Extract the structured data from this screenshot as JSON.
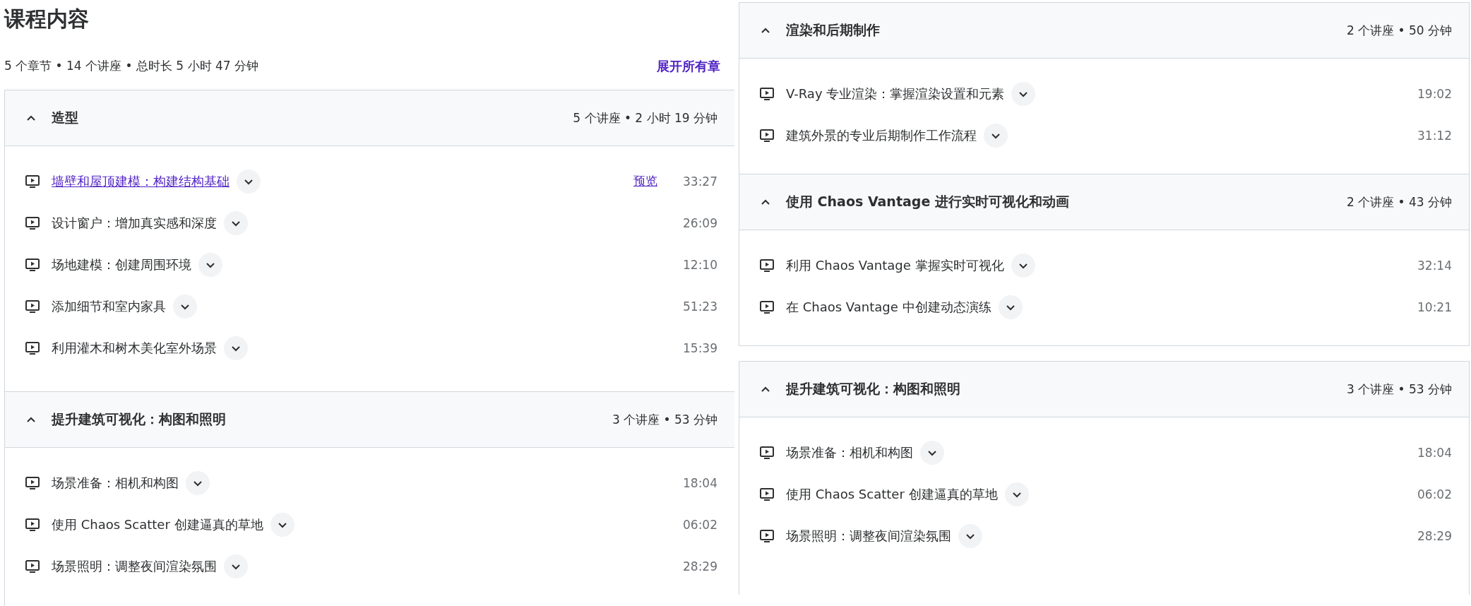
{
  "left_panel": {
    "title": "课程内容",
    "summary": "5 个章节 • 14 个讲座 • 总时长 5 小时 47 分钟",
    "expand_all": "展开所有章",
    "sections": [
      {
        "title": "造型",
        "meta": "5 个讲座 • 2 小时 19 分钟",
        "expanded": true,
        "lectures": [
          {
            "kind": "preview",
            "title": "墙壁和屋顶建模：构建结构基础",
            "preview": "预览",
            "duration": "33:27"
          },
          {
            "kind": "plain",
            "title": "设计窗户：增加真实感和深度",
            "duration": "26:09"
          },
          {
            "kind": "plain",
            "title": "场地建模：创建周围环境",
            "duration": "12:10"
          },
          {
            "kind": "plain",
            "title": "添加细节和室内家具",
            "duration": "51:23"
          },
          {
            "kind": "plain",
            "title": "利用灌木和树木美化室外场景",
            "duration": "15:39"
          }
        ]
      },
      {
        "title": "提升建筑可视化：构图和照明",
        "meta": "3 个讲座 • 53 分钟",
        "expanded": true,
        "lectures": [
          {
            "kind": "plain",
            "title": "场景准备：相机和构图",
            "duration": "18:04"
          },
          {
            "kind": "plain",
            "title": "使用 Chaos Scatter 创建逼真的草地",
            "duration": "06:02"
          },
          {
            "kind": "plain",
            "title": "场景照明：调整夜间渲染氛围",
            "duration": "28:29"
          }
        ]
      }
    ]
  },
  "right_panels": [
    {
      "sections": [
        {
          "title": "渲染和后期制作",
          "meta": "2 个讲座 • 50 分钟",
          "expanded": true,
          "lectures": [
            {
              "kind": "plain",
              "title": "V-Ray 专业渲染：掌握渲染设置和元素",
              "duration": "19:02"
            },
            {
              "kind": "plain",
              "title": "建筑外景的专业后期制作工作流程",
              "duration": "31:12"
            }
          ]
        },
        {
          "title": "使用 Chaos Vantage 进行实时可视化和动画",
          "meta": "2 个讲座 • 43 分钟",
          "expanded": true,
          "lectures": [
            {
              "kind": "plain",
              "title": "利用 Chaos Vantage 掌握实时可视化",
              "duration": "32:14"
            },
            {
              "kind": "plain",
              "title": "在 Chaos Vantage 中创建动态演练",
              "duration": "10:21"
            }
          ]
        }
      ]
    },
    {
      "sections": [
        {
          "title": "提升建筑可视化：构图和照明",
          "meta": "3 个讲座 • 53 分钟",
          "expanded": true,
          "lectures": [
            {
              "kind": "plain",
              "title": "场景准备：相机和构图",
              "duration": "18:04"
            },
            {
              "kind": "plain",
              "title": "使用 Chaos Scatter 创建逼真的草地",
              "duration": "06:02"
            },
            {
              "kind": "plain",
              "title": "场景照明：调整夜间渲染氛围",
              "duration": "28:29"
            }
          ]
        }
      ]
    }
  ]
}
